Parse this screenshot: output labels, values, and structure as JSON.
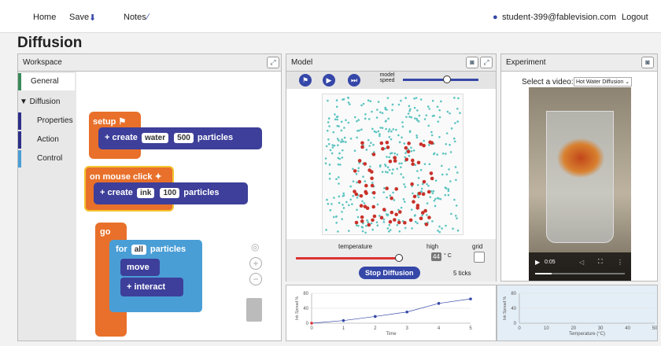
{
  "nav": {
    "home": "Home",
    "save": "Save",
    "notes": "Notes",
    "user": "student-399@fablevision.com",
    "logout": "Logout"
  },
  "page_title": "Diffusion",
  "workspace": {
    "title": "Workspace",
    "categories": [
      "General",
      "▼ Diffusion",
      "Properties",
      "Action",
      "Control"
    ],
    "setup": "setup",
    "create": "create",
    "water": "water",
    "water_count": "500",
    "particles": "particles",
    "mouse": "on mouse click",
    "ink": "ink",
    "ink_count": "100",
    "go": "go",
    "for": "for",
    "all": "all",
    "move": "move",
    "interact": "interact"
  },
  "model": {
    "title": "Model",
    "speed": "model speed",
    "temperature": "temperature",
    "high": "high",
    "temp_value": "44",
    "unit": "° C",
    "grid": "grid",
    "stop": "Stop Diffusion",
    "ticks": "5 ticks"
  },
  "experiment": {
    "title": "Experiment",
    "select_label": "Select a video:",
    "selected": "Hot Water Diffusion",
    "time": "0:05"
  },
  "chart_data": [
    {
      "type": "line",
      "x": [
        0,
        1,
        2,
        3,
        4,
        5
      ],
      "y": [
        0,
        7,
        18,
        30,
        53,
        65
      ],
      "xlabel": "Time",
      "ylabel": "Ink Spread %",
      "ylim": [
        0,
        80
      ],
      "yticks": [
        0,
        40,
        80
      ],
      "xticks": [
        0,
        1,
        2,
        3,
        4,
        5
      ]
    },
    {
      "type": "line",
      "x": [],
      "y": [],
      "xlabel": "Temperature (°C)",
      "ylabel": "Ink Spread %",
      "ylim": [
        0,
        80
      ],
      "yticks": [
        0,
        40,
        80
      ],
      "xticks": [
        0,
        10,
        20,
        30,
        40,
        50
      ]
    }
  ]
}
